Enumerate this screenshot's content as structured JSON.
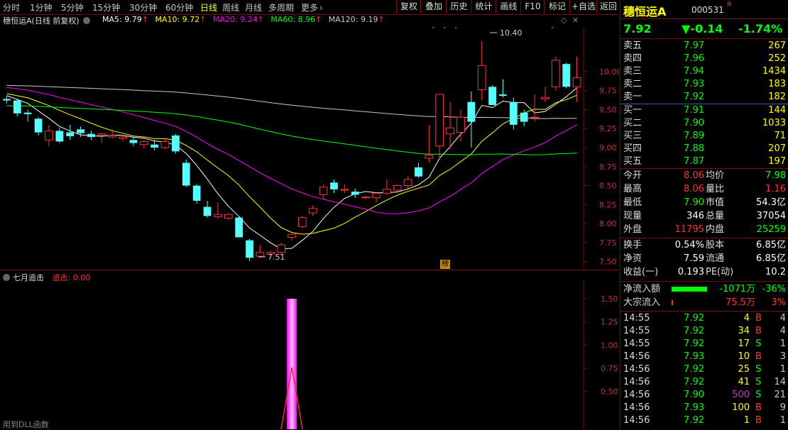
{
  "toolbar": {
    "timeframes": [
      "分时",
      "1分钟",
      "5分钟",
      "15分钟",
      "30分钟",
      "60分钟",
      "日线",
      "周线",
      "月线",
      "多周期",
      "更多"
    ],
    "active_timeframe": "日线",
    "more_suffix": "›",
    "buttons": [
      "复权",
      "叠加",
      "历史",
      "统计",
      "画线",
      "F10",
      "标记",
      "+自选",
      "返回"
    ]
  },
  "chart": {
    "title": "穗恒运A",
    "mode": "(日线 前复权)",
    "ma": [
      {
        "label": "MA5: 9.79",
        "color": "#ffffff"
      },
      {
        "label": "MA10: 9.72",
        "color": "#ffff00"
      },
      {
        "label": "MA20: 9.24",
        "color": "#ff00ff"
      },
      {
        "label": "MA60: 8.96",
        "color": "#00ff00"
      },
      {
        "label": "MA120: 9.19",
        "color": "#c8c8c8"
      }
    ],
    "up_arrow": "↑",
    "price_ticks": [
      "10.00",
      "9.75",
      "9.50",
      "9.25",
      "9.00",
      "8.75",
      "8.50",
      "8.25",
      "8.00",
      "7.75",
      "7.50"
    ],
    "high_label": "10.40",
    "low_label": "7.51",
    "rank_badge": "榜",
    "colors": {
      "up": "#ff3333",
      "down": "#54ffff",
      "bg": "#000000",
      "border": "#7a0d0d"
    }
  },
  "chart_data": {
    "type": "candlestick",
    "ohlc": [
      [
        9.64,
        9.68,
        9.58,
        9.62
      ],
      [
        9.62,
        9.64,
        9.41,
        9.45
      ],
      [
        9.46,
        9.5,
        9.34,
        9.44
      ],
      [
        9.38,
        9.4,
        9.16,
        9.2
      ],
      [
        9.1,
        9.3,
        9.02,
        9.22
      ],
      [
        9.22,
        9.26,
        9.06,
        9.08
      ],
      [
        9.2,
        9.3,
        9.1,
        9.15
      ],
      [
        9.24,
        9.28,
        9.14,
        9.19
      ],
      [
        9.18,
        9.22,
        9.1,
        9.14
      ],
      [
        9.16,
        9.2,
        9.06,
        9.18
      ],
      [
        9.14,
        9.24,
        9.12,
        9.16
      ],
      [
        9.12,
        9.16,
        9.08,
        9.14
      ],
      [
        9.1,
        9.14,
        9.02,
        9.06
      ],
      [
        9.04,
        9.1,
        8.99,
        9.08
      ],
      [
        9.04,
        9.1,
        8.96,
        9.0
      ],
      [
        9.0,
        9.12,
        8.98,
        9.08
      ],
      [
        9.16,
        9.18,
        8.92,
        8.95
      ],
      [
        8.8,
        8.84,
        8.48,
        8.5
      ],
      [
        8.5,
        8.52,
        8.26,
        8.3
      ],
      [
        8.22,
        8.3,
        8.08,
        8.1
      ],
      [
        8.09,
        8.28,
        8.06,
        8.12
      ],
      [
        8.07,
        8.14,
        8.05,
        8.12
      ],
      [
        8.08,
        8.1,
        7.85,
        7.82
      ],
      [
        7.78,
        7.8,
        7.51,
        7.55
      ],
      [
        7.57,
        7.72,
        7.55,
        7.62
      ],
      [
        7.6,
        7.65,
        7.57,
        7.62
      ],
      [
        7.62,
        7.75,
        7.58,
        7.72
      ],
      [
        7.82,
        7.84,
        7.78,
        7.86
      ],
      [
        7.96,
        8.1,
        7.94,
        8.08
      ],
      [
        8.14,
        8.24,
        8.1,
        8.2
      ],
      [
        8.38,
        8.52,
        8.32,
        8.48
      ],
      [
        8.54,
        8.58,
        8.4,
        8.45
      ],
      [
        8.44,
        8.52,
        8.4,
        8.45
      ],
      [
        8.42,
        8.46,
        8.34,
        8.38
      ],
      [
        8.34,
        8.36,
        8.32,
        8.35
      ],
      [
        8.34,
        8.4,
        8.28,
        8.4
      ],
      [
        8.4,
        8.58,
        8.38,
        8.45
      ],
      [
        8.44,
        8.52,
        8.42,
        8.5
      ],
      [
        8.5,
        8.62,
        8.46,
        8.58
      ],
      [
        8.74,
        8.8,
        8.6,
        8.62
      ],
      [
        8.86,
        9.3,
        8.8,
        8.9
      ],
      [
        9.02,
        9.7,
        8.84,
        9.7
      ],
      [
        9.18,
        9.6,
        8.98,
        9.26
      ],
      [
        9.2,
        9.5,
        9.08,
        9.4
      ],
      [
        9.6,
        9.74,
        9.0,
        9.34
      ],
      [
        9.76,
        10.4,
        9.62,
        10.08
      ],
      [
        9.8,
        9.82,
        9.56,
        9.56
      ],
      [
        9.7,
        9.9,
        9.66,
        9.68
      ],
      [
        9.6,
        9.66,
        9.24,
        9.3
      ],
      [
        9.46,
        9.5,
        9.28,
        9.34
      ],
      [
        9.4,
        9.7,
        9.34,
        9.4
      ],
      [
        9.64,
        9.8,
        9.6,
        9.66
      ],
      [
        9.8,
        10.2,
        9.75,
        10.15
      ],
      [
        10.1,
        10.12,
        9.78,
        9.8
      ],
      [
        9.8,
        10.2,
        9.6,
        9.92
      ]
    ],
    "ma_series": [
      "MA5",
      "MA10",
      "MA20",
      "MA60",
      "MA120"
    ],
    "ylim": [
      7.45,
      10.55
    ]
  },
  "indicator": {
    "name": "七月追击",
    "field_label": "追击: ",
    "field_value": "0.00",
    "ticks": [
      "1.50",
      "1.25",
      "1.00",
      "0.75",
      "0.50"
    ],
    "signal_value": 1.5,
    "footer": "用到DLL函数"
  },
  "quote": {
    "name": "穗恒运A",
    "code": "000531",
    "badge": "R",
    "price": "7.92",
    "change": "▼-0.14",
    "pct": "-1.74%",
    "asks": [
      {
        "label": "卖五",
        "price": "7.97",
        "vol": "267"
      },
      {
        "label": "卖四",
        "price": "7.96",
        "vol": "252"
      },
      {
        "label": "卖三",
        "price": "7.94",
        "vol": "1434"
      },
      {
        "label": "卖二",
        "price": "7.93",
        "vol": "183"
      },
      {
        "label": "卖一",
        "price": "7.92",
        "vol": "182"
      }
    ],
    "bids": [
      {
        "label": "买一",
        "price": "7.91",
        "vol": "144"
      },
      {
        "label": "买二",
        "price": "7.90",
        "vol": "1033"
      },
      {
        "label": "买三",
        "price": "7.89",
        "vol": "71"
      },
      {
        "label": "买四",
        "price": "7.88",
        "vol": "207"
      },
      {
        "label": "买五",
        "price": "7.87",
        "vol": "197"
      }
    ],
    "stats": [
      {
        "l1": "今开",
        "v1": "8.06",
        "c1": "#ff3333",
        "l2": "均价",
        "v2": "7.98",
        "c2": "#00ff00"
      },
      {
        "l1": "最高",
        "v1": "8.06",
        "c1": "#ff3333",
        "l2": "量比",
        "v2": "1.16",
        "c2": "#ff3333"
      },
      {
        "l1": "最低",
        "v1": "7.90",
        "c1": "#00ff00",
        "l2": "市值",
        "v2": "54.3亿",
        "c2": "#ffffff"
      },
      {
        "l1": "现量",
        "v1": "346",
        "c1": "#ffffff",
        "l2": "总量",
        "v2": "37054",
        "c2": "#ffffff"
      },
      {
        "l1": "外盘",
        "v1": "11795",
        "c1": "#ff3333",
        "l2": "内盘",
        "v2": "25259",
        "c2": "#00ff00"
      }
    ],
    "stats2": [
      {
        "l1": "换手",
        "v1": "0.54%",
        "l2": "股本",
        "v2": "6.85亿"
      },
      {
        "l1": "净资",
        "v1": "7.59",
        "l2": "流通",
        "v2": "6.85亿"
      },
      {
        "l1": "收益(一)",
        "v1": "0.193",
        "l2": "PE(动)",
        "v2": "10.2"
      }
    ],
    "flow": [
      {
        "label": "净流入额",
        "value": "-1071万",
        "pct": "-36%",
        "color": "#00ff00",
        "bar": 0.9
      },
      {
        "label": "大宗流入",
        "value": "75.5万",
        "pct": "3%",
        "color": "#ff3333",
        "bar": 0.02
      }
    ],
    "ticks": [
      {
        "t": "14:55",
        "p": "7.92",
        "v": "4",
        "d": "B",
        "n": "4",
        "vc": "#ffff00",
        "dc": "#ff3333"
      },
      {
        "t": "14:55",
        "p": "7.92",
        "v": "34",
        "d": "B",
        "n": "4",
        "vc": "#ffff00",
        "dc": "#ff3333"
      },
      {
        "t": "14:55",
        "p": "7.92",
        "v": "17",
        "d": "S",
        "n": "1",
        "vc": "#ffff00",
        "dc": "#00ff00"
      },
      {
        "t": "14:56",
        "p": "7.93",
        "v": "10",
        "d": "B",
        "n": "3",
        "vc": "#ffff00",
        "dc": "#ff3333"
      },
      {
        "t": "14:56",
        "p": "7.92",
        "v": "25",
        "d": "S",
        "n": "1",
        "vc": "#ffff00",
        "dc": "#00ff00"
      },
      {
        "t": "14:56",
        "p": "7.92",
        "v": "41",
        "d": "S",
        "n": "14",
        "vc": "#ffff00",
        "dc": "#00ff00"
      },
      {
        "t": "14:56",
        "p": "7.90",
        "v": "500",
        "d": "S",
        "n": "21",
        "vc": "#cc33cc",
        "dc": "#00ff00"
      },
      {
        "t": "14:56",
        "p": "7.93",
        "v": "100",
        "d": "B",
        "n": "9",
        "vc": "#ffff00",
        "dc": "#ff3333"
      },
      {
        "t": "14:56",
        "p": "7.92",
        "v": "1",
        "d": "B",
        "n": "1",
        "vc": "#ffff00",
        "dc": "#ff3333"
      }
    ]
  }
}
